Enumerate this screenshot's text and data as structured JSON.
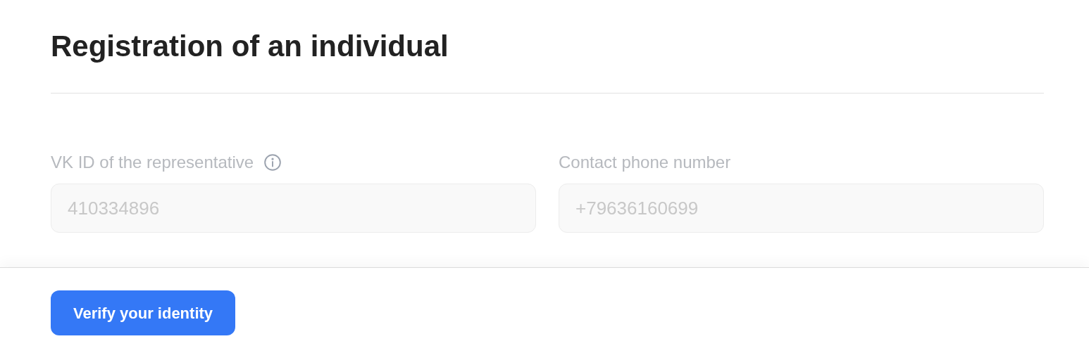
{
  "title": "Registration of an individual",
  "fields": [
    {
      "label": "VK ID of the representative",
      "info": true,
      "value": "410334896",
      "disabled": true
    },
    {
      "label": "Contact phone number",
      "info": false,
      "value": "+79636160699",
      "disabled": true
    }
  ],
  "footer": {
    "button": "Verify your identity"
  }
}
